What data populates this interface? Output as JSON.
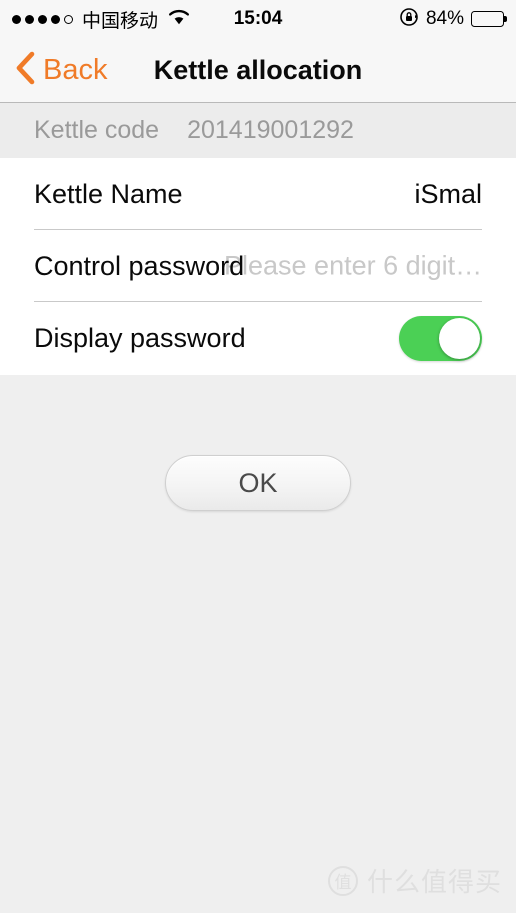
{
  "status_bar": {
    "signal_filled": 4,
    "signal_total": 5,
    "carrier": "中国移动",
    "wifi_icon": "wifi-icon",
    "time": "15:04",
    "rotation_lock_icon": "rotation-lock-icon",
    "battery_percent": "84%",
    "battery_level": 84
  },
  "nav_bar": {
    "back_icon": "chevron-left-icon",
    "back_label": "Back",
    "title": "Kettle allocation",
    "accent_color": "#f07b28"
  },
  "code_band": {
    "label": "Kettle code",
    "value": "201419001292"
  },
  "form": {
    "kettle_name": {
      "label": "Kettle Name",
      "value": "iSmal"
    },
    "control_password": {
      "label": "Control password",
      "value": "",
      "placeholder": "Please enter 6 digit…"
    },
    "display_password": {
      "label": "Display password",
      "state": "on",
      "on_color": "#4bd055"
    }
  },
  "actions": {
    "ok_label": "OK"
  },
  "watermark": {
    "logo_char": "值",
    "text": "什么值得买"
  }
}
